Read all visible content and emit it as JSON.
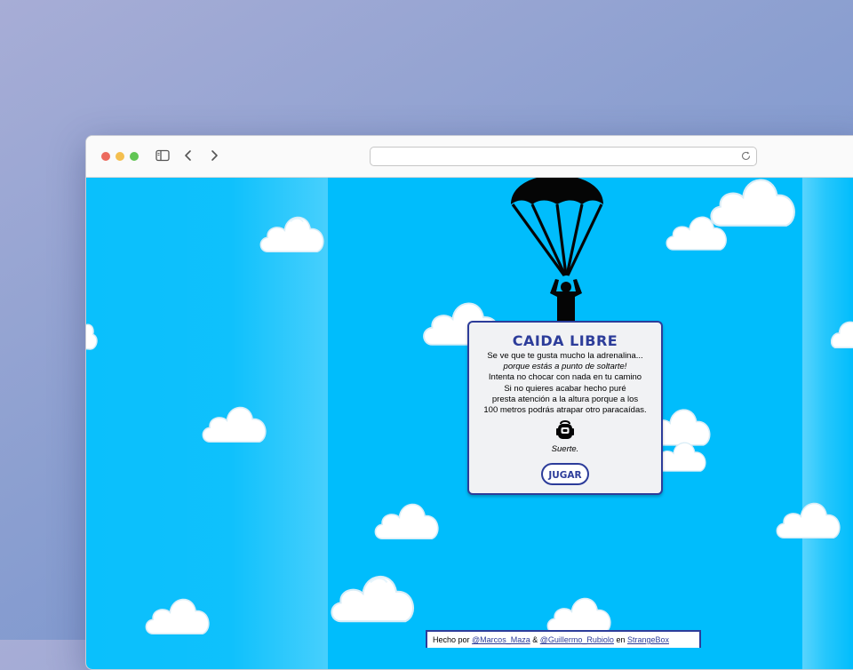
{
  "browser": {
    "toolbar_icons": [
      "sidebar-icon",
      "back-arrow-icon",
      "forward-arrow-icon",
      "reload-icon"
    ]
  },
  "game": {
    "title": "CAIDA LIBRE",
    "intro_lines": [
      "Se ve que te gusta mucho la adrenalina...",
      "porque estás a punto de soltarte!",
      "Intenta no chocar con nada en tu camino",
      "Si no quieres acabar hecho puré",
      "presta atención a la altura porque a los",
      "100 metros podrás atrapar otro paracaídas."
    ],
    "good_luck": "Suerte.",
    "play_button": "JUGAR",
    "footer": {
      "prefix": "Hecho por",
      "author1": "@Marcos_Maza",
      "joiner": "&",
      "author2": "@Guillermo_Rubiolo",
      "suffix": "en",
      "platform": "StrangeBox"
    }
  },
  "colors": {
    "sky": "#00bdfc",
    "accent": "#2d3d9a",
    "card_bg": "#f1f2f4"
  }
}
